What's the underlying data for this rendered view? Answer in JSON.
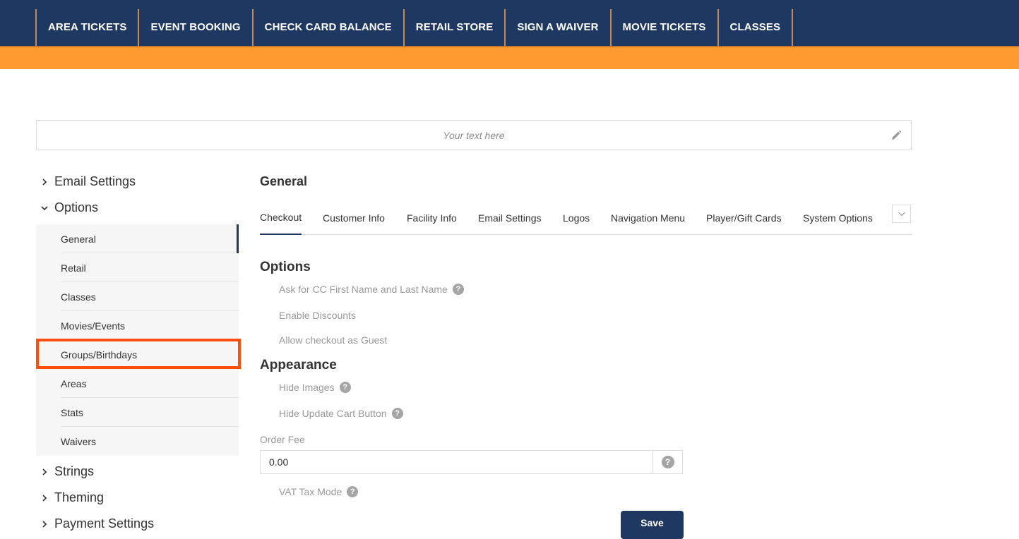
{
  "topnav": {
    "items": [
      "AREA TICKETS",
      "EVENT BOOKING",
      "CHECK CARD BALANCE",
      "RETAIL STORE",
      "SIGN A WAIVER",
      "MOVIE TICKETS",
      "CLASSES"
    ]
  },
  "banner": {
    "placeholder": "Your text here",
    "edit_icon": "pencil-icon"
  },
  "sidebar": {
    "sections": {
      "email_settings": "Email Settings",
      "options": "Options",
      "strings": "Strings",
      "theming": "Theming",
      "payment_settings": "Payment Settings"
    },
    "options_items": [
      "General",
      "Retail",
      "Classes",
      "Movies/Events",
      "Groups/Birthdays",
      "Areas",
      "Stats",
      "Waivers"
    ],
    "active_item": "General",
    "highlighted_item": "Groups/Birthdays"
  },
  "main": {
    "title": "General",
    "tabs": [
      "Checkout",
      "Customer Info",
      "Facility Info",
      "Email Settings",
      "Logos",
      "Navigation Menu",
      "Player/Gift Cards",
      "System Options"
    ],
    "active_tab": "Checkout",
    "options_heading": "Options",
    "options": {
      "cc_name": "Ask for CC First Name and Last Name",
      "discounts": "Enable Discounts",
      "guest": "Allow checkout as Guest"
    },
    "appearance_heading": "Appearance",
    "appearance": {
      "hide_images": "Hide Images",
      "hide_update_cart": "Hide Update Cart Button"
    },
    "order_fee_label": "Order Fee",
    "order_fee_value": "0.00",
    "vat_tax_mode": "VAT Tax Mode",
    "help_glyph": "?",
    "save_label": "Save"
  },
  "colors": {
    "navy": "#1e3862",
    "orange": "#ff9a30",
    "highlight": "#ff4f0e"
  }
}
